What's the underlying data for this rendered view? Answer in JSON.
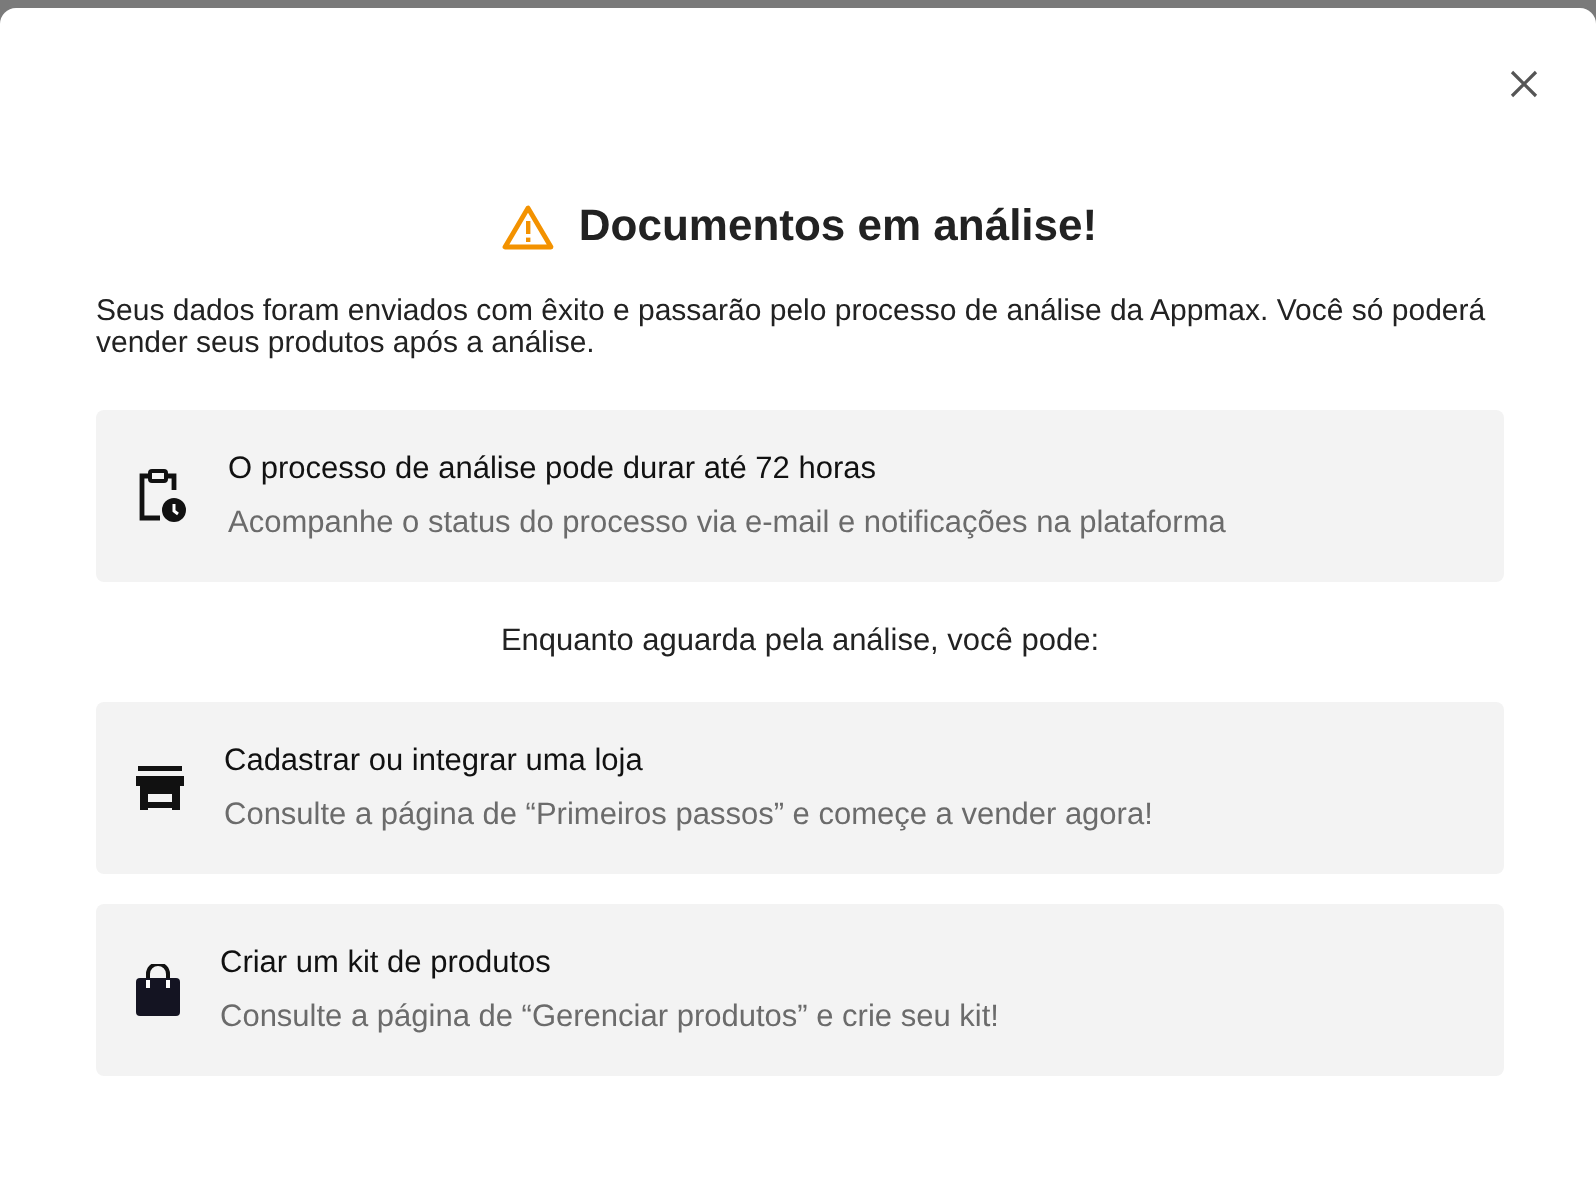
{
  "dialog": {
    "title": "Documentos em análise!",
    "intro": "Seus dados foram enviados com êxito e passarão pelo processo de análise da Appmax. Você só poderá vender seus produtos após a análise.",
    "notice": {
      "kind": "clock",
      "title": "O processo de análise pode durar até 72 horas",
      "text": "Acompanhe o status do processo via e-mail e notificações na plataforma"
    },
    "subheading": "Enquanto aguarda pela análise, você pode:",
    "options": [
      {
        "kind": "store",
        "title": "Cadastrar ou integrar uma loja",
        "text": "Consulte a página de “Primeiros passos” e começe a vender agora!"
      },
      {
        "kind": "bag",
        "title": "Criar um kit de produtos",
        "text": "Consulte a página de “Gerenciar produtos” e crie seu kit!"
      }
    ]
  }
}
